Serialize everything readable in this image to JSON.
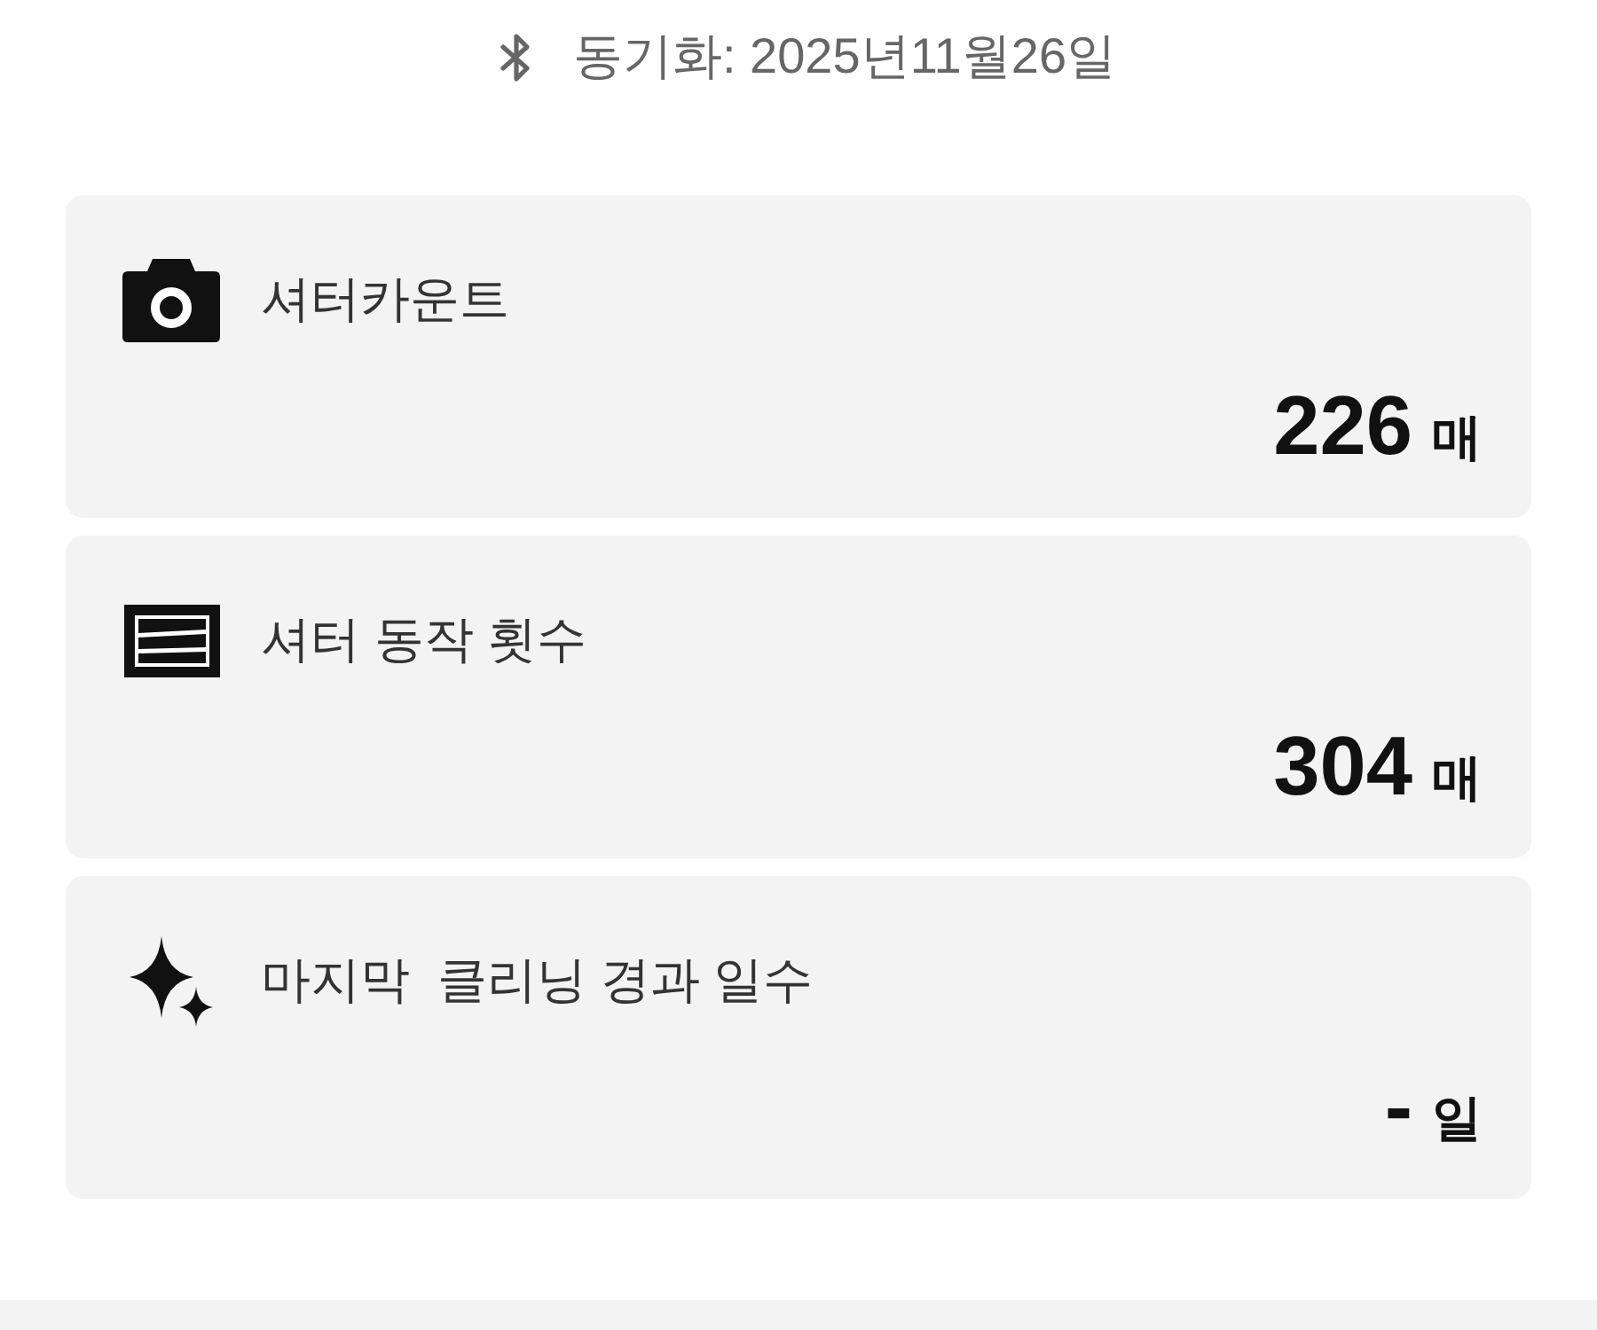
{
  "sync": {
    "label": "동기화: 2025년11월26일"
  },
  "cards": [
    {
      "kind": "camera",
      "label": "셔터카운트",
      "value": "226",
      "unit": "매"
    },
    {
      "kind": "shutter",
      "label": "셔터 동작 횟수",
      "value": "304",
      "unit": "매"
    },
    {
      "kind": "sparkle",
      "label": "마지막  클리닝 경과 일수",
      "value": "-",
      "unit": "일"
    }
  ]
}
